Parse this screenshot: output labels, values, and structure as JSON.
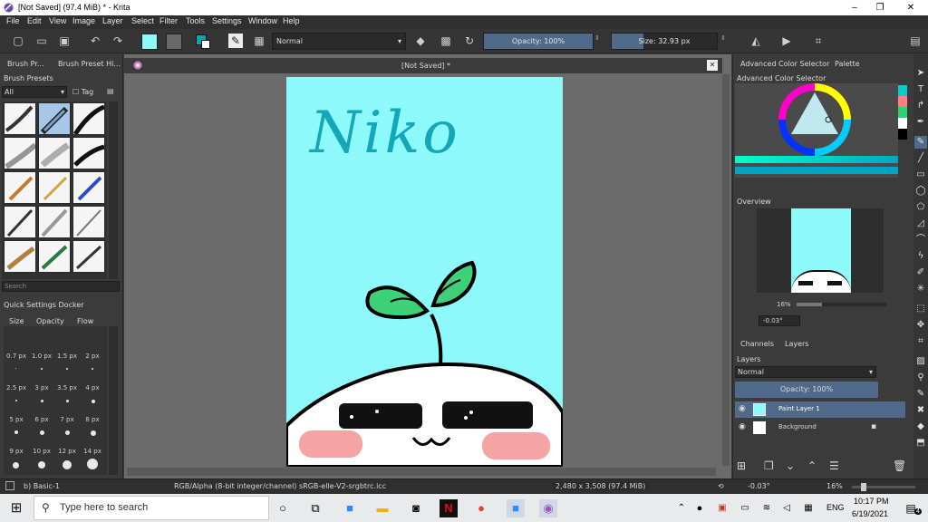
{
  "window": {
    "title": "[Not Saved]  (97.4 MiB)  * - Krita",
    "min": "–",
    "max": "❐",
    "close": "✕"
  },
  "menu": [
    "File",
    "Edit",
    "View",
    "Image",
    "Layer",
    "Select",
    "Filter",
    "Tools",
    "Settings",
    "Window",
    "Help"
  ],
  "toolbar": {
    "blend_mode": "Normal",
    "opacity": "Opacity: 100%",
    "opacity_value": 100,
    "size": "Size: 32.93 px"
  },
  "left_dock": {
    "tab1": "Brush Pr...",
    "tab2": "Brush Preset Hi...",
    "title": "Brush Presets",
    "filter": "All",
    "tag": "Tag",
    "search_placeholder": "Search",
    "quick_title": "Quick Settings Docker",
    "quick_tabs": [
      "Size",
      "Opacity",
      "Flow"
    ],
    "sizes": [
      "0.7 px",
      "1.0 px",
      "1.5 px",
      "2 px",
      "2.5 px",
      "3 px",
      "3.5 px",
      "4 px",
      "5 px",
      "6 px",
      "7 px",
      "8 px",
      "9 px",
      "10 px",
      "12 px",
      "14 px"
    ]
  },
  "canvas": {
    "doc_title": "[Not Saved]  *",
    "close": "✕",
    "text": "Niko"
  },
  "right_dock": {
    "tab1": "Advanced Color Selector",
    "tab2": "Palette",
    "acs_title": "Advanced Color Selector",
    "overview_title": "Overview",
    "overview_zoom": "16%",
    "overview_rotation": "-0.03°",
    "layer_tabs": [
      "Channels",
      "Layers"
    ],
    "layers_title": "Layers",
    "blend": "Normal",
    "opacity": "Opacity:  100%",
    "layers": [
      {
        "name": "Paint Layer 1",
        "selected": true
      },
      {
        "name": "Background",
        "selected": false
      }
    ]
  },
  "status": {
    "brush": "b) Basic-1",
    "color_space": "RGB/Alpha (8-bit integer/channel)  sRGB-elle-V2-srgbtrc.icc",
    "dims": "2,480 x 3,508 (97.4 MiB)",
    "rotation": "-0.03°",
    "zoom": "16%"
  },
  "taskbar": {
    "search_placeholder": "Type here to search",
    "lang": "ENG",
    "time": "10:17 PM",
    "date": "6/19/2021",
    "notifications": "4"
  },
  "colors": {
    "canvas_bg": "#8ef9fb",
    "accent": "#4f6a8a",
    "leaf": "#3fd07a"
  }
}
